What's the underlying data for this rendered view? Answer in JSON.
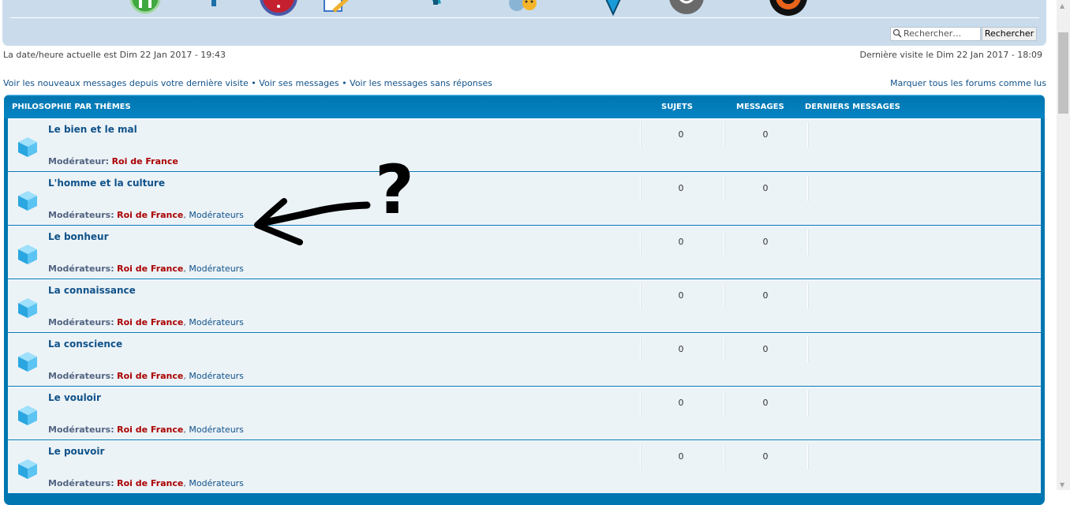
{
  "header": {
    "search_placeholder": "Rechercher…",
    "search_button": "Rechercher"
  },
  "nav_icons": [
    "forum-icon",
    "members-icon",
    "help-icon",
    "edit-icon",
    "user-icon",
    "smileys-icon",
    "location-icon",
    "chat-icon",
    "target-icon"
  ],
  "info": {
    "current_date": "La date/heure actuelle est Dim 22 Jan 2017 - 19:43",
    "last_visit": "Dernière visite le Dim 22 Jan 2017 - 18:09"
  },
  "links": {
    "new_messages": "Voir les nouveaux messages depuis votre dernière visite",
    "sep1": " • ",
    "your_messages": "Voir ses messages",
    "sep2": " • ",
    "unanswered": "Voir les messages sans réponses",
    "mark_read": "Marquer tous les forums comme lus"
  },
  "category": {
    "title": "PHILOSOPHIE PAR THÈMES",
    "col_topics": "SUJETS",
    "col_messages": "MESSAGES",
    "col_last": "DERNIERS MESSAGES"
  },
  "forums": [
    {
      "title": "Le bien et le mal",
      "mod_label": "Modérateur:",
      "mod_user": "Roi de France",
      "mod_group": "",
      "topics": "0",
      "messages": "0"
    },
    {
      "title": "L'homme et la culture",
      "mod_label": "Modérateurs:",
      "mod_user": "Roi de France",
      "mod_group": "Modérateurs",
      "topics": "0",
      "messages": "0"
    },
    {
      "title": "Le bonheur",
      "mod_label": "Modérateurs:",
      "mod_user": "Roi de France",
      "mod_group": "Modérateurs",
      "topics": "0",
      "messages": "0"
    },
    {
      "title": "La connaissance",
      "mod_label": "Modérateurs:",
      "mod_user": "Roi de France",
      "mod_group": "Modérateurs",
      "topics": "0",
      "messages": "0"
    },
    {
      "title": "La conscience",
      "mod_label": "Modérateurs:",
      "mod_user": "Roi de France",
      "mod_group": "Modérateurs",
      "topics": "0",
      "messages": "0"
    },
    {
      "title": "Le vouloir",
      "mod_label": "Modérateurs:",
      "mod_user": "Roi de France",
      "mod_group": "Modérateurs",
      "topics": "0",
      "messages": "0"
    },
    {
      "title": "Le pouvoir",
      "mod_label": "Modérateurs:",
      "mod_user": "Roi de France",
      "mod_group": "Modérateurs",
      "topics": "0",
      "messages": "0"
    }
  ],
  "annotation": {
    "symbol": "?"
  },
  "colors": {
    "link": "#105289",
    "moderator_user": "#aa0000",
    "category_header": "#0076b1",
    "row_bg": "#ecf3f7",
    "top_panel": "#cadceb"
  }
}
